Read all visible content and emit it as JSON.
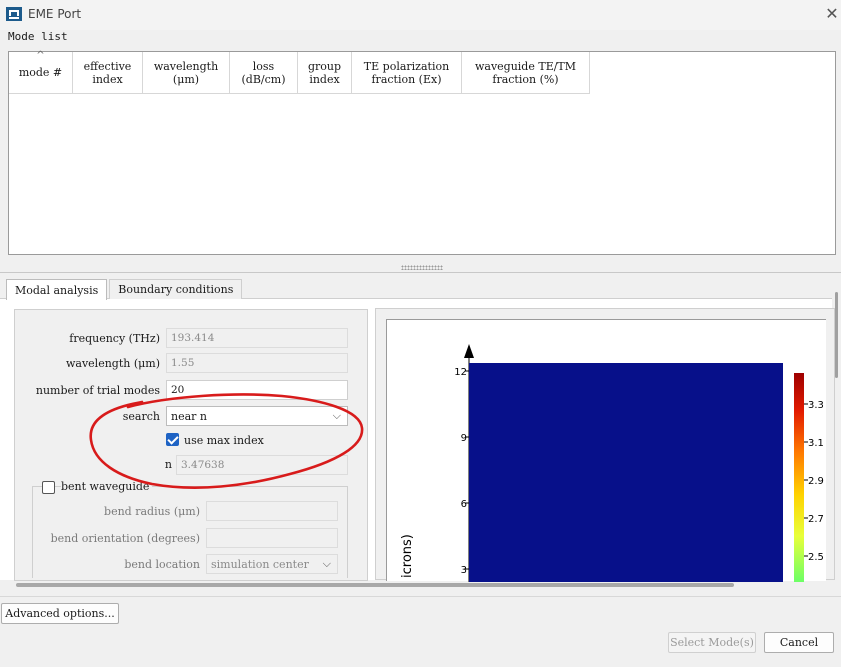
{
  "window": {
    "title": "EME Port",
    "app_icon": "app-logo-icon",
    "close_icon": "close-icon"
  },
  "mode_list": {
    "label": "Mode list",
    "columns": [
      "mode #",
      "effective\nindex",
      "wavelength\n(μm)",
      "loss\n(dB/cm)",
      "group\nindex",
      "TE polarization\nfraction (Ex)",
      "waveguide TE/TM\nfraction (%)"
    ],
    "rows": []
  },
  "tabs": [
    {
      "label": "Modal analysis",
      "active": true
    },
    {
      "label": "Boundary conditions",
      "active": false
    }
  ],
  "modal_analysis": {
    "frequency_label": "frequency (THz)",
    "frequency_value": "193.414",
    "wavelength_label": "wavelength (μm)",
    "wavelength_value": "1.55",
    "trial_modes_label": "number of trial modes",
    "trial_modes_value": "20",
    "search_label": "search",
    "search_value": "near n",
    "use_max_index_label": "use max index",
    "use_max_index_checked": true,
    "n_label": "n",
    "n_value": "3.47638",
    "bent_waveguide_label": "bent waveguide",
    "bent_waveguide_checked": false,
    "bend_radius_label": "bend radius (μm)",
    "bend_radius_value": "",
    "bend_orientation_label": "bend orientation (degrees)",
    "bend_orientation_value": "",
    "bend_location_label": "bend location",
    "bend_location_value": "simulation center"
  },
  "plot": {
    "y_ticks": [
      "12",
      "9",
      "6",
      "3"
    ],
    "y_label_partial": "icrons)",
    "fill_color": "#07108a",
    "colorbar_ticks": [
      "3.3",
      "3.1",
      "2.9",
      "2.7",
      "2.5"
    ]
  },
  "buttons": {
    "advanced_options": "Advanced options...",
    "select_modes": "Select Mode(s)",
    "cancel": "Cancel"
  },
  "colors": {
    "annotation": "#d81b1b",
    "accent": "#1e63c4"
  }
}
